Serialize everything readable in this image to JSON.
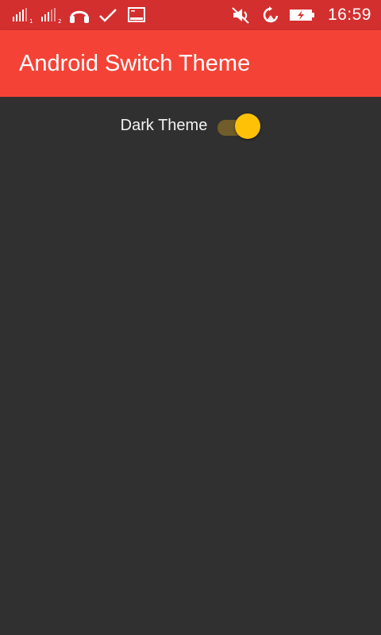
{
  "status_bar": {
    "time": "16:59",
    "icons_left": [
      "signal-sim1-icon",
      "signal-sim2-icon",
      "headphones-icon",
      "check-icon",
      "screenshot-icon"
    ],
    "icons_right": [
      "vibrate-mute-icon",
      "sync-icon",
      "battery-charging-icon"
    ]
  },
  "app_bar": {
    "title": "Android Switch Theme"
  },
  "main": {
    "switch_label": "Dark Theme",
    "switch_checked": true
  },
  "colors": {
    "status_bar": "#d32f2f",
    "app_bar": "#f44336",
    "background": "#303030",
    "switch_thumb": "#ffc107",
    "switch_track": "#715d2a",
    "text": "#f2f2f2"
  }
}
